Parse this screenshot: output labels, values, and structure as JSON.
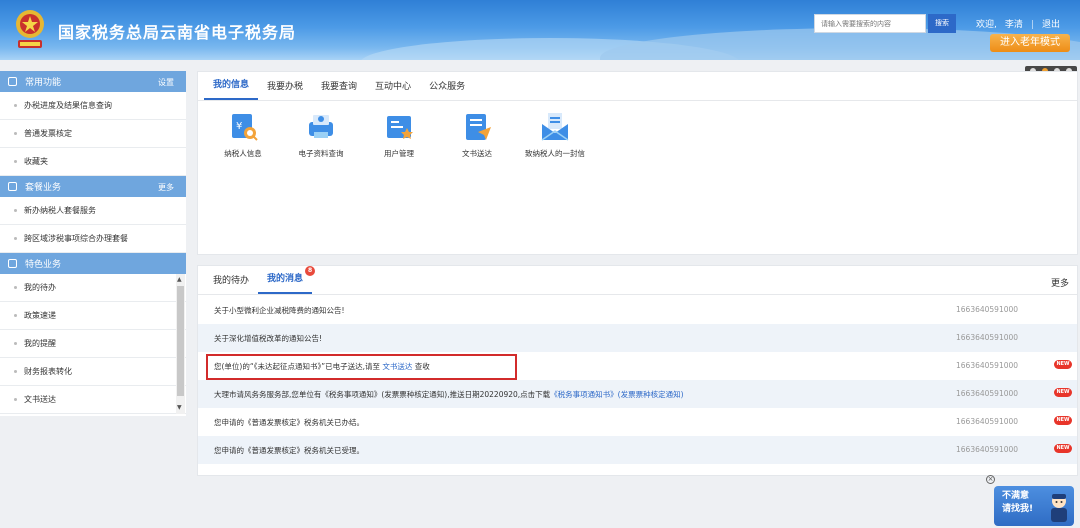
{
  "header": {
    "title": "国家税务总局云南省电子税务局",
    "search_placeholder": "请输入需要搜索的内容",
    "search_button": "搜索",
    "welcome": "欢迎,",
    "user_name": "李清",
    "logout": "退出",
    "elder_mode": "进入老年模式"
  },
  "sidebar": {
    "sections": [
      {
        "title": "常用功能",
        "action": "设置",
        "items": [
          "办税进度及结果信息查询",
          "普通发票核定",
          "收藏夹"
        ]
      },
      {
        "title": "套餐业务",
        "action": "更多",
        "items": [
          "新办纳税人套餐服务",
          "跨区域涉税事项综合办理套餐"
        ]
      },
      {
        "title": "特色业务",
        "action": "",
        "items": [
          "我的待办",
          "政策速递",
          "我的提醒",
          "财务报表转化",
          "文书送达"
        ]
      }
    ]
  },
  "top_panel": {
    "tabs": [
      "我的信息",
      "我要办税",
      "我要查询",
      "互动中心",
      "公众服务"
    ],
    "active_tab": 0,
    "tiles": [
      {
        "label": "纳税人信息",
        "icon": "taxpayer-info-icon"
      },
      {
        "label": "电子资料查询",
        "icon": "e-document-query-icon"
      },
      {
        "label": "用户管理",
        "icon": "user-management-icon"
      },
      {
        "label": "文书送达",
        "icon": "document-delivery-icon"
      },
      {
        "label": "致纳税人的一封信",
        "icon": "letter-icon"
      }
    ]
  },
  "message_panel": {
    "tabs": [
      "我的待办",
      "我的消息"
    ],
    "active_tab": 1,
    "badge": "8",
    "more": "更多",
    "rows": [
      {
        "text": "关于小型微利企业减税降费的通知公告!",
        "time": "1663640591000",
        "new": false
      },
      {
        "text": "关于深化增值税改革的通知公告!",
        "time": "1663640591000",
        "new": false
      },
      {
        "text_pre": "您(单位)的“《未达起征点通知书》”已电子送达,请至 ",
        "link": "文书送达",
        "text_post": " 查收",
        "time": "1663640591000",
        "new": true
      },
      {
        "text_pre": "大理市请风务务服务部,您单位有《税务事项通知》(发票票种核定通知),推送日期20220920,点击下载",
        "link": "《税务事项通知书》(发票票种核定通知)",
        "text_post": "",
        "time": "1663640591000",
        "new": true
      },
      {
        "text": "您申请的《普通发票核定》税务机关已办结。",
        "time": "1663640591000",
        "new": true
      },
      {
        "text": "您申请的《普通发票核定》税务机关已受理。",
        "time": "1663640591000",
        "new": true
      }
    ],
    "new_label": "NEW"
  },
  "feedback": {
    "line1": "不满意",
    "line2": "请找我!"
  },
  "colors": {
    "accent": "#2d69c8",
    "sidebar_head": "#6fa6de",
    "highlight": "#d22b2b",
    "new_badge": "#e8352a"
  }
}
